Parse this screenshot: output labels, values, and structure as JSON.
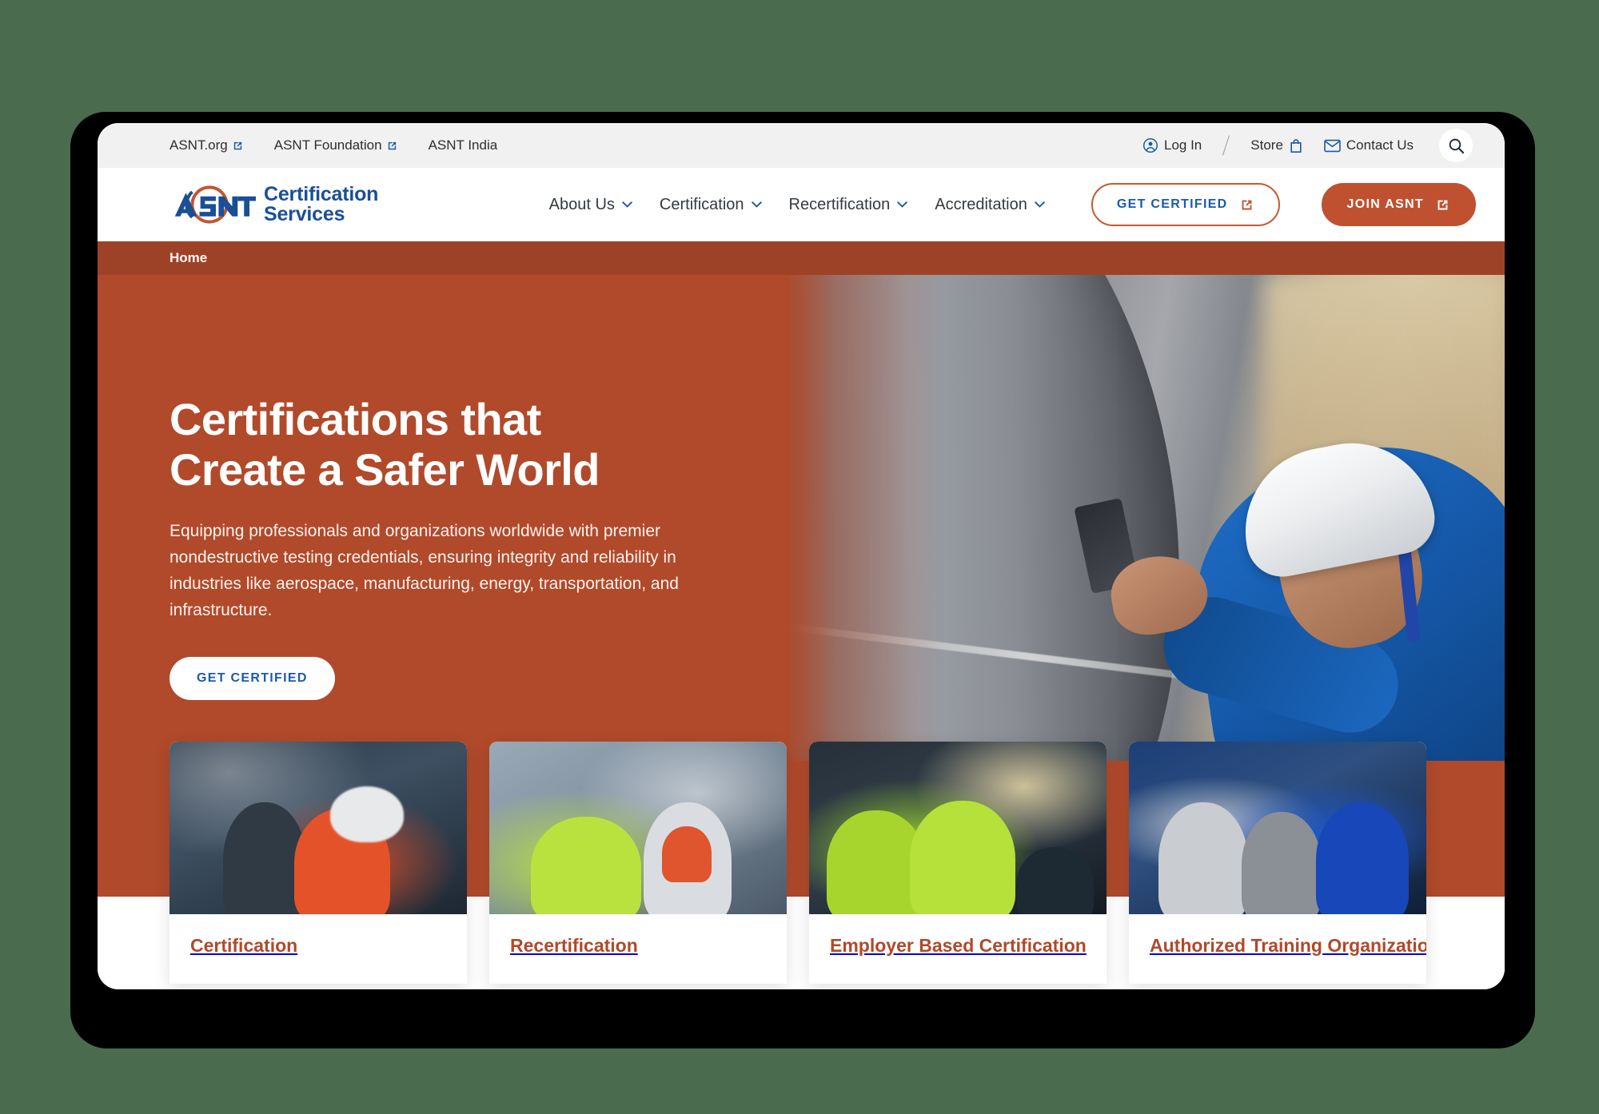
{
  "utility_bar": {
    "left_links": [
      {
        "label": "ASNT.org",
        "external": true,
        "name": "asnt-org-link"
      },
      {
        "label": "ASNT Foundation",
        "external": true,
        "name": "asnt-foundation-link"
      },
      {
        "label": "ASNT India",
        "external": false,
        "name": "asnt-india-link"
      }
    ],
    "right_links": [
      {
        "label": "Log In",
        "icon": "user-circle-icon",
        "name": "log-in-link"
      },
      {
        "label": "Store",
        "icon": "shopping-bag-icon",
        "name": "store-link"
      },
      {
        "label": "Contact Us",
        "icon": "envelope-icon",
        "name": "contact-us-link"
      }
    ],
    "search_icon": "search-icon"
  },
  "header": {
    "logo": {
      "acronym": "ASNT",
      "line1": "Certification",
      "line2": "Services"
    },
    "nav": [
      {
        "label": "About Us",
        "has_dropdown": true
      },
      {
        "label": "Certification",
        "has_dropdown": true
      },
      {
        "label": "Recertification",
        "has_dropdown": true
      },
      {
        "label": "Accreditation",
        "has_dropdown": true
      }
    ],
    "cta_outline": {
      "label": "GET CERTIFIED",
      "icon": "external-link-icon"
    },
    "cta_solid": {
      "label": "JOIN ASNT",
      "icon": "external-link-icon"
    }
  },
  "breadcrumb": {
    "items": [
      {
        "label": "Home"
      }
    ]
  },
  "hero": {
    "title": "Certifications that Create a Safer World",
    "subtitle": "Equipping professionals and organizations worldwide with premier nondestructive testing credentials, ensuring integrity and reliability in industries like aerospace, manufacturing, energy, transportation, and infrastructure.",
    "cta_label": "GET CERTIFIED",
    "image_alt": "NDT inspector in white hard hat and blue coveralls measuring a weld seam on a large steel pipe"
  },
  "cards": [
    {
      "title": "Certification",
      "image_alt": "Two workers with hard hats reviewing a tablet in a steel mill with sparks"
    },
    {
      "title": "Recertification",
      "image_alt": "Two engineers in high-visibility vests with a laptop inside a factory"
    },
    {
      "title": "Employer Based Certification",
      "image_alt": "Two technicians in green hi-vis jackets smiling at a laptop"
    },
    {
      "title": "Authorized Training Organization",
      "image_alt": "Three aviation technicians reviewing a tablet beside an aircraft engine"
    }
  ],
  "colors": {
    "brand_terracotta": "#b04a2b",
    "breadcrumb_bar": "#9e4227",
    "brand_blue": "#1a4f96",
    "link_blue": "#1a5bab",
    "card_title": "#b0492a",
    "utility_bar_bg": "#f1f1f1",
    "page_bg": "#4a6b4e"
  }
}
